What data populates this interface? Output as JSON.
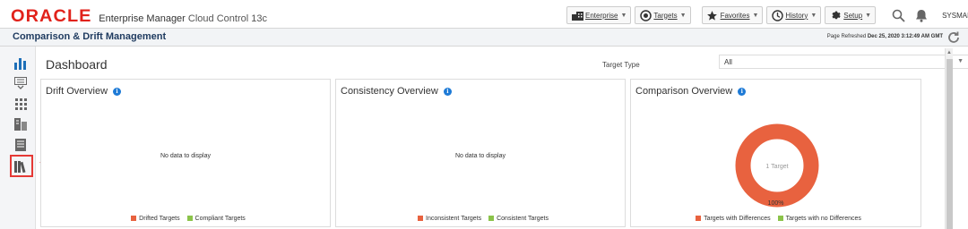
{
  "header": {
    "brand": "ORACLE",
    "product": "Enterprise Manager",
    "edition": "Cloud Control 13c",
    "menus": [
      {
        "label": "Enterprise",
        "icon": "enterprise-icon"
      },
      {
        "label": "Targets",
        "icon": "targets-icon"
      },
      {
        "label": "Favorites",
        "icon": "star-icon"
      },
      {
        "label": "History",
        "icon": "clock-icon"
      },
      {
        "label": "Setup",
        "icon": "gear-icon"
      }
    ],
    "user": "SYSMAN",
    "more": "•••"
  },
  "titlebar": {
    "title": "Comparison & Drift Management",
    "refresh_label": "Page Refreshed",
    "refresh_time": "Dec 25, 2020 3:12:49 AM GMT"
  },
  "leftnav": [
    "dashboard-icon",
    "drift-icon",
    "comparisons-icon",
    "templates-icon",
    "reports-icon",
    "library-icon"
  ],
  "dashboard": {
    "title": "Dashboard",
    "target_type_label": "Target Type",
    "target_type_value": "All"
  },
  "panels": [
    {
      "title": "Drift Overview",
      "message": "No data to display",
      "legend": [
        "Drifted Targets",
        "Compliant Targets"
      ]
    },
    {
      "title": "Consistency Overview",
      "message": "No data to display",
      "legend": [
        "Inconsistent Targets",
        "Consistent Targets"
      ]
    },
    {
      "title": "Comparison Overview",
      "center_label": "1 Target",
      "percent_label": "100%",
      "legend": [
        "Targets with Differences",
        "Targets with no Differences"
      ]
    }
  ],
  "colors": {
    "accent_red": "#e8623f",
    "accent_green": "#8bc34a",
    "oracle_red": "#e1221b",
    "highlight": "#e53935"
  },
  "chart_data": {
    "type": "pie",
    "categories": [
      "Targets with Differences",
      "Targets with no Differences"
    ],
    "values": [
      1,
      0
    ],
    "title": "Comparison Overview"
  }
}
